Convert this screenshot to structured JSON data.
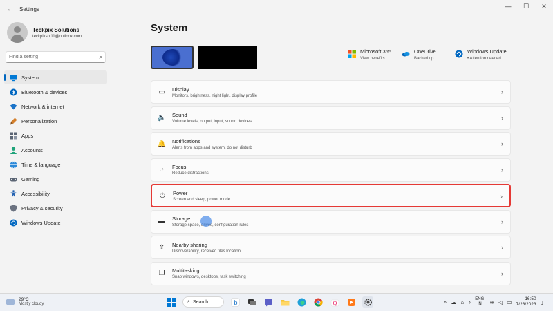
{
  "window": {
    "title": "Settings",
    "back_glyph": "←",
    "minimize": "—",
    "maximize": "☐",
    "close": "✕"
  },
  "profile": {
    "name": "Teckpix Solutions",
    "email": "teckpixsol11@outlook.com"
  },
  "search": {
    "placeholder": "Find a setting",
    "icon": "search-icon"
  },
  "sidebar": {
    "items": [
      {
        "label": "System",
        "icon": "system-icon",
        "color": "#0078d4",
        "active": true
      },
      {
        "label": "Bluetooth & devices",
        "icon": "bluetooth-icon",
        "color": "#0067c0"
      },
      {
        "label": "Network & internet",
        "icon": "wifi-icon",
        "color": "#1a73c8"
      },
      {
        "label": "Personalization",
        "icon": "brush-icon",
        "color": "#d47f2a"
      },
      {
        "label": "Apps",
        "icon": "apps-icon",
        "color": "#5b6574"
      },
      {
        "label": "Accounts",
        "icon": "accounts-icon",
        "color": "#1fa37a"
      },
      {
        "label": "Time & language",
        "icon": "globe-icon",
        "color": "#2b88d8"
      },
      {
        "label": "Gaming",
        "icon": "gaming-icon",
        "color": "#5b6574"
      },
      {
        "label": "Accessibility",
        "icon": "accessibility-icon",
        "color": "#1f5fb0"
      },
      {
        "label": "Privacy & security",
        "icon": "shield-icon",
        "color": "#6b7280"
      },
      {
        "label": "Windows Update",
        "icon": "windows-update-icon",
        "color": "#0067c0"
      }
    ]
  },
  "main": {
    "title": "System",
    "quick_links": [
      {
        "title": "Microsoft 365",
        "subtitle": "View benefits",
        "icon": "microsoft-365-icon"
      },
      {
        "title": "OneDrive",
        "subtitle": "Backed up",
        "icon": "onedrive-icon"
      },
      {
        "title": "Windows Update",
        "subtitle": "• Attention needed",
        "icon": "windows-update-icon"
      }
    ],
    "cards": [
      {
        "title": "Display",
        "subtitle": "Monitors, brightness, night light, display profile",
        "icon": "display-icon",
        "glyph": "▭"
      },
      {
        "title": "Sound",
        "subtitle": "Volume levels, output, input, sound devices",
        "icon": "sound-icon",
        "glyph": "🔈"
      },
      {
        "title": "Notifications",
        "subtitle": "Alerts from apps and system, do not disturb",
        "icon": "bell-icon",
        "glyph": "🔔"
      },
      {
        "title": "Focus",
        "subtitle": "Reduce distractions",
        "icon": "focus-icon",
        "glyph": "◔"
      },
      {
        "title": "Power",
        "subtitle": "Screen and sleep, power mode",
        "icon": "power-icon",
        "glyph": "⏻",
        "highlighted": true
      },
      {
        "title": "Storage",
        "subtitle": "Storage space, drives, configuration rules",
        "icon": "storage-icon",
        "glyph": "▬"
      },
      {
        "title": "Nearby sharing",
        "subtitle": "Discoverability, received files location",
        "icon": "share-icon",
        "glyph": "⇪"
      },
      {
        "title": "Multitasking",
        "subtitle": "Snap windows, desktops, task switching",
        "icon": "multitasking-icon",
        "glyph": "❐"
      }
    ],
    "chevron": "›"
  },
  "taskbar": {
    "weather": {
      "temp": "29°C",
      "condition": "Mostly cloudy"
    },
    "search_label": "Search",
    "language": {
      "line1": "ENG",
      "line2": "IN"
    },
    "clock": {
      "time": "16:50",
      "date": "7/28/2023"
    }
  }
}
